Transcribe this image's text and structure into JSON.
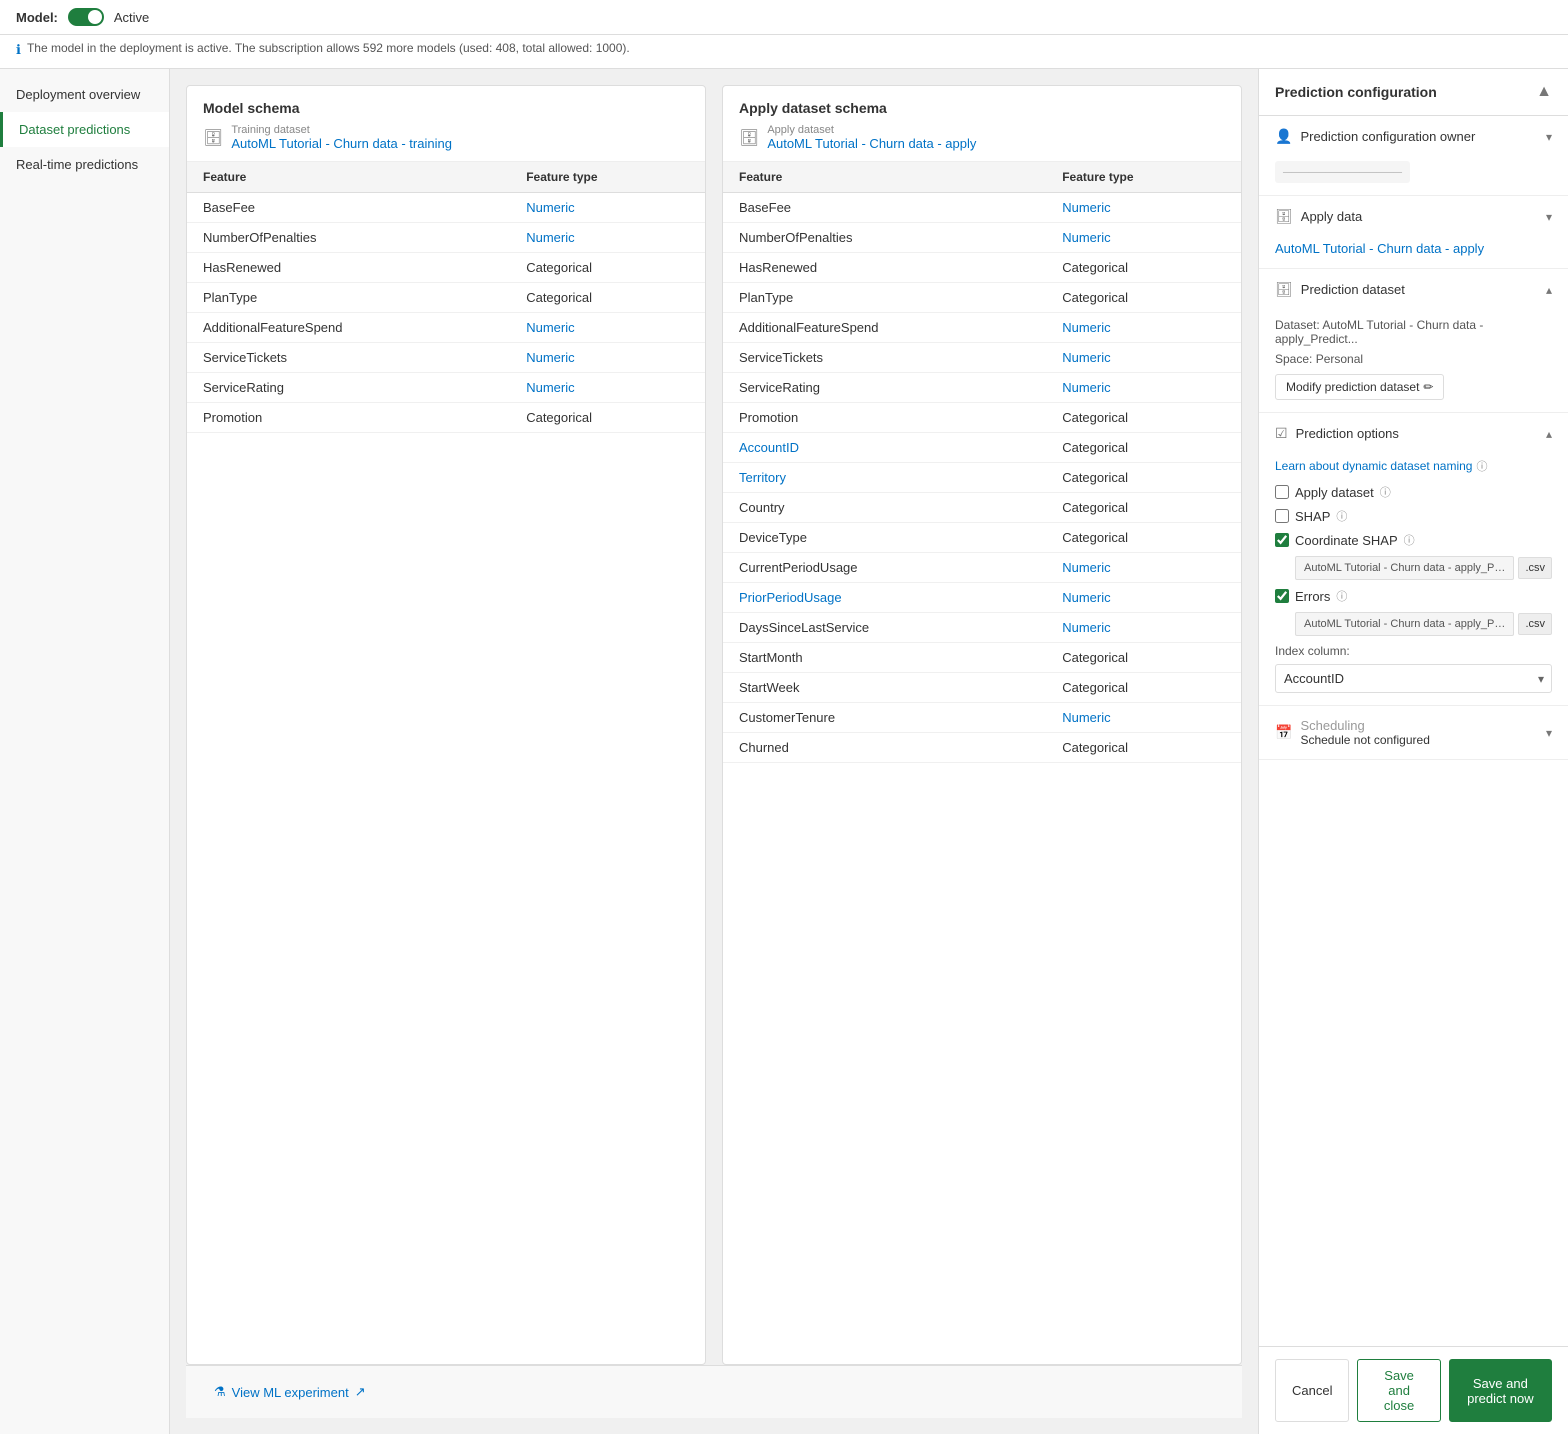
{
  "topBar": {
    "modelLabel": "Model:",
    "activeLabel": "Active",
    "infoText": "The model in the deployment is active. The subscription allows 592 more models (used: 408, total allowed: 1000)."
  },
  "sidebar": {
    "items": [
      {
        "label": "Deployment overview",
        "active": false
      },
      {
        "label": "Dataset predictions",
        "active": true
      },
      {
        "label": "Real-time predictions",
        "active": false
      }
    ]
  },
  "modelSchema": {
    "title": "Model schema",
    "datasetLabel": "Training dataset",
    "datasetName": "AutoML Tutorial - Churn data - training",
    "columns": [
      "Feature",
      "Feature type"
    ],
    "rows": [
      {
        "feature": "BaseFee",
        "type": "Numeric",
        "linked": false
      },
      {
        "feature": "NumberOfPenalties",
        "type": "Numeric",
        "linked": false
      },
      {
        "feature": "HasRenewed",
        "type": "Categorical",
        "linked": false
      },
      {
        "feature": "PlanType",
        "type": "Categorical",
        "linked": false
      },
      {
        "feature": "AdditionalFeatureSpend",
        "type": "Numeric",
        "linked": false
      },
      {
        "feature": "ServiceTickets",
        "type": "Numeric",
        "linked": false
      },
      {
        "feature": "ServiceRating",
        "type": "Numeric",
        "linked": false
      },
      {
        "feature": "Promotion",
        "type": "Categorical",
        "linked": false
      }
    ]
  },
  "applySchema": {
    "title": "Apply dataset schema",
    "datasetLabel": "Apply dataset",
    "datasetName": "AutoML Tutorial - Churn data - apply",
    "columns": [
      "Feature",
      "Feature type"
    ],
    "rows": [
      {
        "feature": "BaseFee",
        "type": "Numeric",
        "linked": false
      },
      {
        "feature": "NumberOfPenalties",
        "type": "Numeric",
        "linked": false
      },
      {
        "feature": "HasRenewed",
        "type": "Categorical",
        "linked": false
      },
      {
        "feature": "PlanType",
        "type": "Categorical",
        "linked": false
      },
      {
        "feature": "AdditionalFeatureSpend",
        "type": "Numeric",
        "linked": false
      },
      {
        "feature": "ServiceTickets",
        "type": "Numeric",
        "linked": false
      },
      {
        "feature": "ServiceRating",
        "type": "Numeric",
        "linked": false
      },
      {
        "feature": "Promotion",
        "type": "Categorical",
        "linked": false
      },
      {
        "feature": "AccountID",
        "type": "Categorical",
        "linked": true
      },
      {
        "feature": "Territory",
        "type": "Categorical",
        "linked": true
      },
      {
        "feature": "Country",
        "type": "Categorical",
        "linked": false
      },
      {
        "feature": "DeviceType",
        "type": "Categorical",
        "linked": false
      },
      {
        "feature": "CurrentPeriodUsage",
        "type": "Numeric",
        "linked": false
      },
      {
        "feature": "PriorPeriodUsage",
        "type": "Numeric",
        "linked": true
      },
      {
        "feature": "DaysSinceLastService",
        "type": "Numeric",
        "linked": false
      },
      {
        "feature": "StartMonth",
        "type": "Categorical",
        "linked": false
      },
      {
        "feature": "StartWeek",
        "type": "Categorical",
        "linked": false
      },
      {
        "feature": "CustomerTenure",
        "type": "Numeric",
        "linked": false
      },
      {
        "feature": "Churned",
        "type": "Categorical",
        "linked": false
      }
    ]
  },
  "viewExperiment": "View ML experiment",
  "rightPanel": {
    "title": "Prediction configuration",
    "collapseIcon": "▲",
    "sections": {
      "configOwner": {
        "title": "Prediction configuration owner",
        "ownerPlaceholder": "──────────────"
      },
      "applyData": {
        "title": "Apply data",
        "value": "AutoML Tutorial - Churn data - apply"
      },
      "predictionDataset": {
        "title": "Prediction dataset",
        "datasetText": "Dataset: AutoML Tutorial - Churn data - apply_Predict...",
        "spaceText": "Space: Personal",
        "modifyBtn": "Modify prediction dataset"
      },
      "predictionOptions": {
        "title": "Prediction options",
        "learnLink": "Learn about dynamic dataset naming",
        "options": [
          {
            "label": "Apply dataset",
            "checked": false,
            "hasInfo": true
          },
          {
            "label": "SHAP",
            "checked": false,
            "hasInfo": true
          }
        ],
        "coordinateShap": {
          "label": "Coordinate SHAP",
          "checked": true,
          "hasInfo": true,
          "inputValue": "AutoML Tutorial - Churn data - apply_Predictic",
          "csvLabel": ".csv"
        },
        "errors": {
          "label": "Errors",
          "checked": true,
          "hasInfo": true,
          "inputValue": "AutoML Tutorial - Churn data - apply_Predictic",
          "csvLabel": ".csv"
        },
        "indexColumn": {
          "label": "Index column:",
          "value": "AccountID"
        }
      },
      "scheduling": {
        "title": "Scheduling",
        "subtitle": "Schedule not configured"
      }
    }
  },
  "footer": {
    "cancelLabel": "Cancel",
    "saveCloseLabel": "Save and close",
    "savePredictLabel": "Save and predict now"
  }
}
